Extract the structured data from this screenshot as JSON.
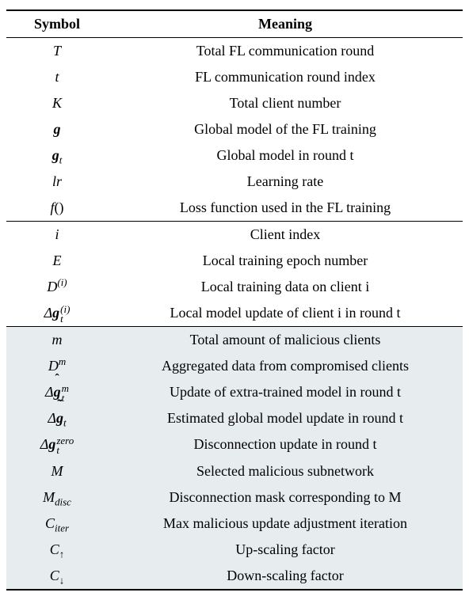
{
  "chart_data": {
    "type": "table",
    "title": "",
    "header": {
      "symbol": "Symbol",
      "meaning": "Meaning"
    },
    "sections": [
      {
        "shaded": false,
        "rows": [
          {
            "symbol_html": "<span class='sym'>T</span>",
            "meaning": "Total FL communication round"
          },
          {
            "symbol_html": "<span class='sym'>t</span>",
            "meaning": "FL communication round index"
          },
          {
            "symbol_html": "<span class='sym'>K</span>",
            "meaning": "Total client number"
          },
          {
            "symbol_html": "<span class='sym bold-it'>g</span>",
            "meaning": "Global model of the FL training"
          },
          {
            "symbol_html": "<span class='sym'><span class='bold-it'>g</span><span class='sub'>t</span></span>",
            "meaning": "Global model in round t"
          },
          {
            "symbol_html": "<span class='sym'>lr</span>",
            "meaning": "Learning rate"
          },
          {
            "symbol_html": "<span class='sym'>f<span class='nonit'>()</span></span>",
            "meaning": "Loss function used in the FL training"
          }
        ]
      },
      {
        "shaded": false,
        "rows": [
          {
            "symbol_html": "<span class='sym'>i</span>",
            "meaning": "Client index"
          },
          {
            "symbol_html": "<span class='sym'>E</span>",
            "meaning": "Local training epoch number"
          },
          {
            "symbol_html": "<span class='sym'>D<span class='sup'>(i)</span></span>",
            "meaning": "Local training data on client i"
          },
          {
            "symbol_html": "<span class='sym'>Δ<span class='bold-it'>g</span><span class='supsub'><span>(i)</span><span>t</span></span></span>",
            "meaning": "Local model update of client i in round t"
          }
        ]
      },
      {
        "shaded": true,
        "rows": [
          {
            "symbol_html": "<span class='sym'>m</span>",
            "meaning": "Total amount of malicious clients"
          },
          {
            "symbol_html": "<span class='sym'>D<span class='sup'>m</span></span>",
            "meaning": "Aggregated data from compromised clients"
          },
          {
            "symbol_html": "<span class='sym'>Δ<span class='hat-over bold-it'>g</span><span class='supsub'><span>m</span><span>t</span></span></span>",
            "meaning": "Update of extra-trained model in round t"
          },
          {
            "symbol_html": "<span class='sym'>Δ<span class='tilde-over bold-it'>g</span><span class='sub'>t</span></span>",
            "meaning": "Estimated global model update in round t"
          },
          {
            "symbol_html": "<span class='sym'>Δ<span class='bold-it'>g</span><span class='supsub'><span>zero</span><span>t</span></span></span>",
            "meaning": "Disconnection update in round t"
          },
          {
            "symbol_html": "<span class='sym'>M</span>",
            "meaning": "Selected malicious subnetwork"
          },
          {
            "symbol_html": "<span class='sym'>M<span class='sub'>disc</span></span>",
            "meaning": "Disconnection mask corresponding to M"
          },
          {
            "symbol_html": "<span class='sym'>C<span class='sub'>iter</span></span>",
            "meaning": "Max malicious update adjustment iteration"
          },
          {
            "symbol_html": "<span class='sym'>C<span class='sub nonit'>↑</span></span>",
            "meaning": "Up-scaling factor"
          },
          {
            "symbol_html": "<span class='sym'>C<span class='sub nonit'>↓</span></span>",
            "meaning": "Down-scaling factor"
          }
        ]
      }
    ]
  }
}
